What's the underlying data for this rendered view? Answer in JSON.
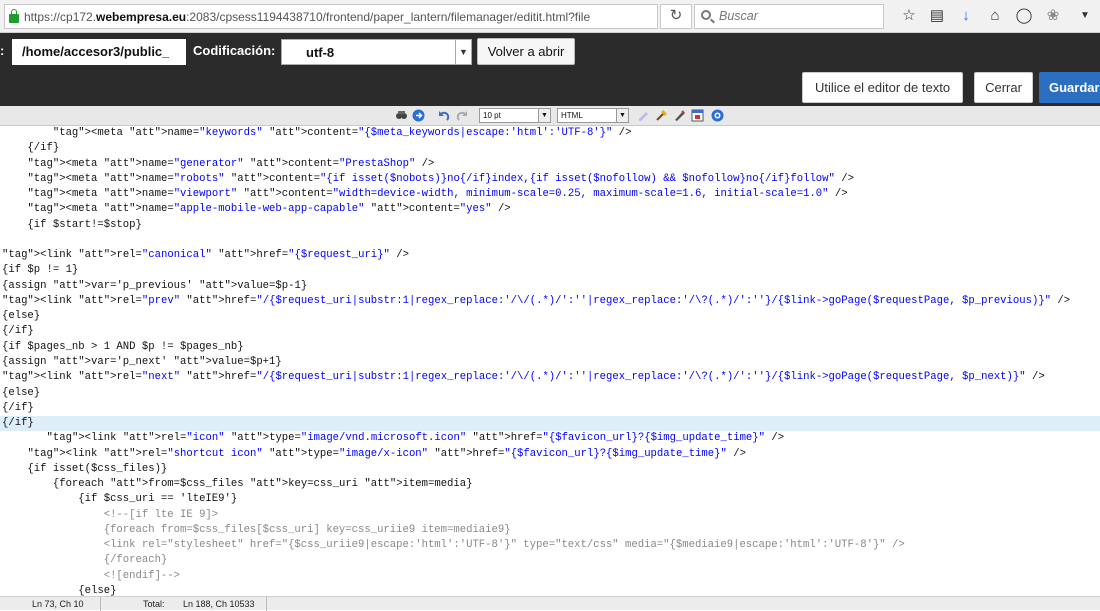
{
  "browser": {
    "url_prefix": "https://cp172.",
    "url_domain": "webempresa.eu",
    "url_rest": ":2083/cpsess1194438710/frontend/paper_lantern/filemanager/editit.html?file",
    "search_placeholder": "Buscar"
  },
  "header": {
    "path_label": ":",
    "path_value": "/home/accesor3/public_",
    "encoding_label": "Codificación:",
    "encoding_value": "utf-8",
    "reopen_label": "Volver a abrir"
  },
  "actions": {
    "editor_label": "Utilice el editor de texto",
    "close_label": "Cerrar",
    "save_label": "Guardar"
  },
  "toolbar": {
    "font_size": "10 pt",
    "syntax": "HTML"
  },
  "code_lines": [
    {
      "text": "        <meta name=\"keywords\" content=\"{$meta_keywords|escape:'html':'UTF-8'}\" />",
      "type": "meta"
    },
    {
      "text": "    {/if}",
      "type": "plain"
    },
    {
      "text": "    <meta name=\"generator\" content=\"PrestaShop\" />",
      "type": "meta"
    },
    {
      "text": "    <meta name=\"robots\" content=\"{if isset($nobots)}no{/if}index,{if isset($nofollow) && $nofollow}no{/if}follow\" />",
      "type": "meta"
    },
    {
      "text": "    <meta name=\"viewport\" content=\"width=device-width, minimum-scale=0.25, maximum-scale=1.6, initial-scale=1.0\" />",
      "type": "meta"
    },
    {
      "text": "    <meta name=\"apple-mobile-web-app-capable\" content=\"yes\" />",
      "type": "meta"
    },
    {
      "text": "    {if $start!=$stop}",
      "type": "plain"
    },
    {
      "text": "",
      "type": "plain"
    },
    {
      "text": "<link rel=\"canonical\" href=\"{$request_uri}\" />",
      "type": "link"
    },
    {
      "text": "{if $p != 1}",
      "type": "plain"
    },
    {
      "text": "{assign var='p_previous' value=$p-1}",
      "type": "plain"
    },
    {
      "text": "<link rel=\"prev\" href=\"/{$request_uri|substr:1|regex_replace:'/\\/(.*)/':''|regex_replace:'/\\?(.*)/':''}/{$link->goPage($requestPage, $p_previous)}\" />",
      "type": "link"
    },
    {
      "text": "{else}",
      "type": "plain"
    },
    {
      "text": "{/if}",
      "type": "plain"
    },
    {
      "text": "{if $pages_nb > 1 AND $p != $pages_nb}",
      "type": "plain"
    },
    {
      "text": "{assign var='p_next' value=$p+1}",
      "type": "plain"
    },
    {
      "text": "<link rel=\"next\" href=\"/{$request_uri|substr:1|regex_replace:'/\\/(.*)/':''|regex_replace:'/\\?(.*)/':''}/{$link->goPage($requestPage, $p_next)}\" />",
      "type": "link"
    },
    {
      "text": "{else}",
      "type": "plain"
    },
    {
      "text": "{/if}",
      "type": "plain"
    },
    {
      "text": "{/if}",
      "type": "plain",
      "active": true
    },
    {
      "text": "       <link rel=\"icon\" type=\"image/vnd.microsoft.icon\" href=\"{$favicon_url}?{$img_update_time}\" />",
      "type": "link"
    },
    {
      "text": "    <link rel=\"shortcut icon\" type=\"image/x-icon\" href=\"{$favicon_url}?{$img_update_time}\" />",
      "type": "link"
    },
    {
      "text": "    {if isset($css_files)}",
      "type": "plain"
    },
    {
      "text": "        {foreach from=$css_files key=css_uri item=media}",
      "type": "plain"
    },
    {
      "text": "            {if $css_uri == 'lteIE9'}",
      "type": "plain"
    },
    {
      "text": "                <!--[if lte IE 9]>",
      "type": "muted"
    },
    {
      "text": "                {foreach from=$css_files[$css_uri] key=css_uriie9 item=mediaie9}",
      "type": "muted"
    },
    {
      "text": "                <link rel=\"stylesheet\" href=\"{$css_uriie9|escape:'html':'UTF-8'}\" type=\"text/css\" media=\"{$mediaie9|escape:'html':'UTF-8'}\" />",
      "type": "muted"
    },
    {
      "text": "                {/foreach}",
      "type": "muted"
    },
    {
      "text": "                <![endif]-->",
      "type": "muted"
    },
    {
      "text": "            {else}",
      "type": "plain"
    }
  ],
  "status": {
    "position": "Ln 73, Ch 10",
    "total_label": "Total:",
    "total_value": "Ln 188, Ch 10533"
  }
}
